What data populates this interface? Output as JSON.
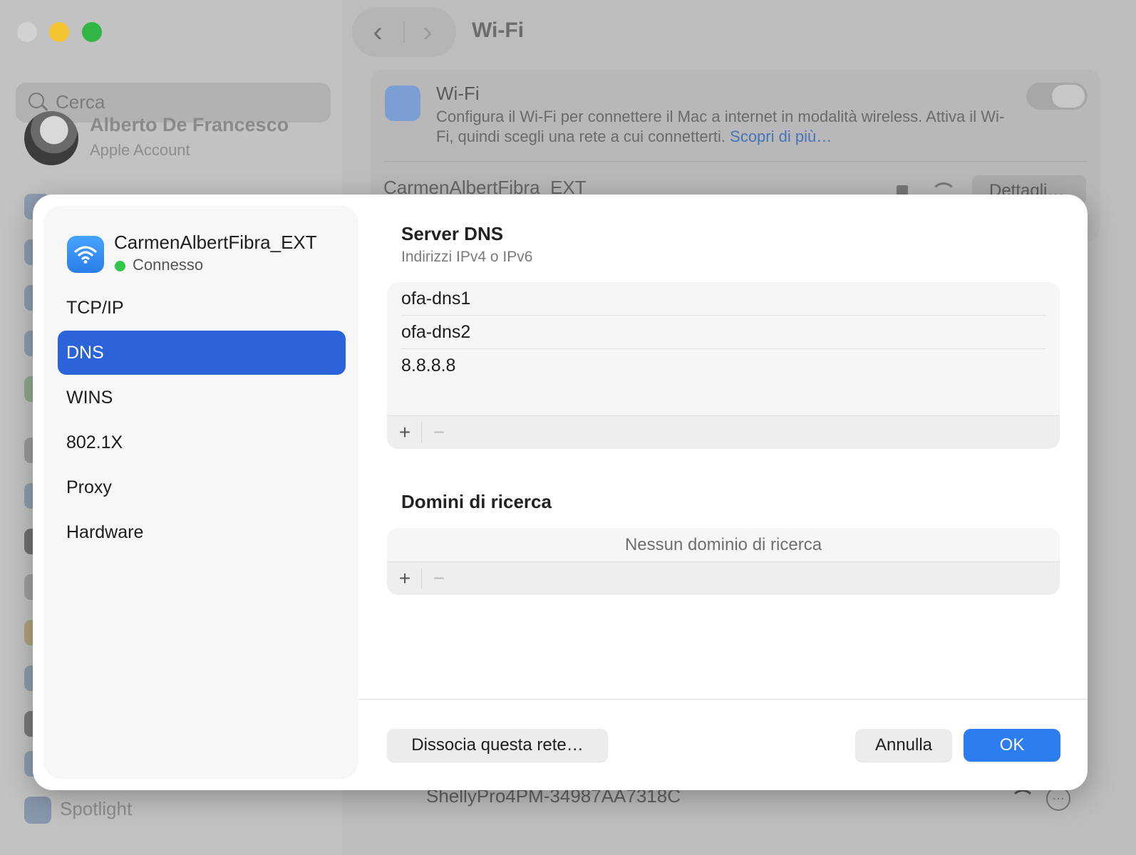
{
  "window": {
    "title": "Wi-Fi",
    "nav_back": "‹",
    "nav_forward": "›"
  },
  "sidebar": {
    "search_placeholder": "Cerca",
    "account_name": "Alberto De Francesco",
    "account_sub": "Apple Account",
    "spotlight_label": "Spotlight"
  },
  "wifi_card": {
    "title": "Wi-Fi",
    "description": "Configura il Wi-Fi per connettere il Mac a internet in modalità wireless. Attiva il Wi-Fi, quindi scegli una rete a cui connetterti.",
    "link": "Scopri di più…",
    "network_name": "CarmenAlbertFibra_EXT",
    "details_button": "Dettagli…"
  },
  "background_list": {
    "network_name": "ShellyPro4PM-34987AA7318C",
    "more_glyph": "···"
  },
  "sheet": {
    "network_name": "CarmenAlbertFibra_EXT",
    "status": "Connesso",
    "status_color": "#31c748",
    "menu": [
      {
        "label": "TCP/IP",
        "selected": false
      },
      {
        "label": "DNS",
        "selected": true
      },
      {
        "label": "WINS",
        "selected": false
      },
      {
        "label": "802.1X",
        "selected": false
      },
      {
        "label": "Proxy",
        "selected": false
      },
      {
        "label": "Hardware",
        "selected": false
      }
    ],
    "dns": {
      "title": "Server DNS",
      "subtitle": "Indirizzi IPv4 o IPv6",
      "servers": [
        "ofa-dns1",
        "ofa-dns2",
        "8.8.8.8"
      ],
      "add": "+",
      "remove": "−"
    },
    "domains": {
      "title": "Domini di ricerca",
      "empty": "Nessun dominio di ricerca",
      "add": "+",
      "remove": "−"
    },
    "buttons": {
      "forget": "Dissocia questa rete…",
      "cancel": "Annulla",
      "ok": "OK"
    },
    "accent_color": "#2b63db",
    "ok_color": "#2d7df1"
  }
}
